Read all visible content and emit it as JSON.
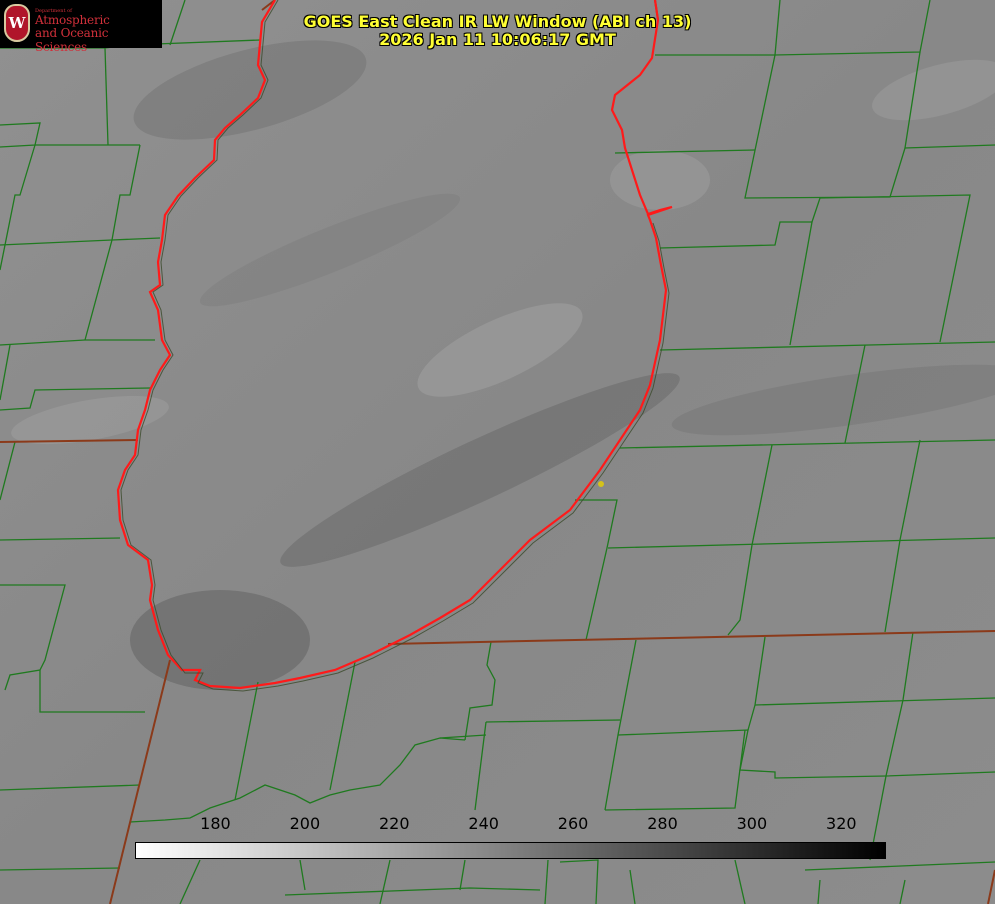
{
  "title": {
    "line1": "GOES East Clean IR LW Window (ABI ch 13)",
    "line2": "2026 Jan 11 10:06:17 GMT"
  },
  "logo": {
    "department": "Department of",
    "line1": "Atmospheric",
    "line2": "and Oceanic Sciences",
    "seal": "W"
  },
  "colorbar": {
    "ticks": [
      "180",
      "200",
      "220",
      "240",
      "260",
      "280",
      "300",
      "320"
    ],
    "min": 162,
    "max": 330,
    "colormap": "white-to-black"
  },
  "colors": {
    "county_lines": "#1f7a1f",
    "state_lines": "#8b3a1a",
    "lake_outline": "#ff1a1a",
    "title_text": "#ffff33",
    "marker": "#d4c21a"
  }
}
